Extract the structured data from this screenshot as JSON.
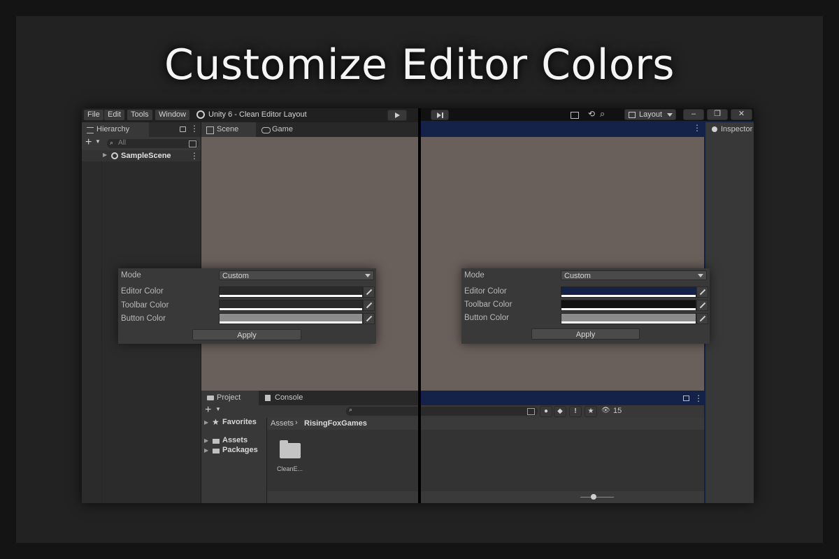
{
  "headline": "Customize Editor Colors",
  "colors": {
    "editor_blue": "#14224a",
    "scene_bg": "#695f5b",
    "panel_bg": "#383838",
    "toolbar_bg": "#272727"
  },
  "menubar": {
    "items": [
      "File",
      "Edit",
      "Tools",
      "Window"
    ],
    "title": "Unity 6 - Clean Editor Layout",
    "layout_label": "Layout"
  },
  "hierarchy": {
    "tab": "Hierarchy",
    "search_placeholder": "All",
    "scene": "SampleScene"
  },
  "center_tabs": {
    "scene": "Scene",
    "game": "Game"
  },
  "inspector": {
    "tab": "Inspector"
  },
  "project": {
    "tab_project": "Project",
    "tab_console": "Console",
    "tree": [
      "Favorites",
      "Assets",
      "Packages"
    ],
    "breadcrumb_root": "Assets",
    "breadcrumb_leaf": "RisingFoxGames",
    "folder_name": "CleanE...",
    "visible_count": "15",
    "zoom_level": 0.35
  },
  "settings_left": {
    "mode_label": "Mode",
    "mode_value": "Custom",
    "editor_color_label": "Editor Color",
    "toolbar_color_label": "Toolbar Color",
    "button_color_label": "Button Color",
    "editor_color": "#2a2a2a",
    "toolbar_color": "#2a2a2a",
    "button_color": "#8c8c8c",
    "apply": "Apply"
  },
  "settings_right": {
    "mode_label": "Mode",
    "mode_value": "Custom",
    "editor_color_label": "Editor Color",
    "toolbar_color_label": "Toolbar Color",
    "button_color_label": "Button Color",
    "editor_color": "#14224a",
    "toolbar_color": "#111111",
    "button_color": "#8c8c8c",
    "apply": "Apply"
  }
}
